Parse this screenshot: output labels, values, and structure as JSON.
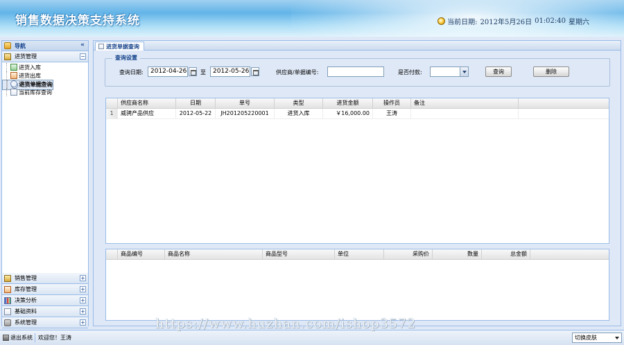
{
  "header": {
    "title": "销售数据决策支持系统",
    "date_label": "当前日期:",
    "date_value": "2012年5月26日",
    "time_value": "01:02:40",
    "weekday": "星期六"
  },
  "sidebar": {
    "title": "导航",
    "collapse_glyph": "«",
    "active_group": {
      "label": "进货管理",
      "toggle": "−",
      "items": [
        {
          "label": "进货入库",
          "icon": "stock-in-icon"
        },
        {
          "label": "进货出库",
          "icon": "stock-out-icon"
        },
        {
          "label": "进货单据查询",
          "icon": "search-doc-icon"
        },
        {
          "label": "退货单据查询",
          "icon": "search-doc-icon"
        },
        {
          "label": "当前库存查询",
          "icon": "doc-icon"
        }
      ],
      "selected_index": 2
    },
    "groups": [
      {
        "label": "销售管理",
        "toggle": "+"
      },
      {
        "label": "库存管理",
        "toggle": "+"
      },
      {
        "label": "决策分析",
        "toggle": "+"
      },
      {
        "label": "基础资料",
        "toggle": "+"
      },
      {
        "label": "系统管理",
        "toggle": "+"
      }
    ]
  },
  "tab": {
    "label": "进货单据查询"
  },
  "query": {
    "legend": "查询设置",
    "date_label": "查询日期:",
    "date_from": "2012-04-26",
    "date_sep": "至",
    "date_to": "2012-05-26",
    "supplier_label": "供应商/单据编号:",
    "supplier_value": "",
    "paid_label": "是否付款:",
    "paid_value": "",
    "search_button": "查询",
    "delete_button": "删除"
  },
  "orders": {
    "columns": [
      "供应商名称",
      "日期",
      "单号",
      "类型",
      "进货金额",
      "操作员",
      "备注"
    ],
    "rows": [
      {
        "num": "1",
        "supplier": "威骋产品供应",
        "date": "2012-05-22",
        "order_no": "JH201205220001",
        "type": "进货入库",
        "amount": "￥16,000.00",
        "operator": "王涛",
        "note": ""
      }
    ]
  },
  "details": {
    "columns": [
      "商品编号",
      "商品名称",
      "商品型号",
      "单位",
      "采购价",
      "数量",
      "总金额"
    ]
  },
  "footer": {
    "logout": "退出系统",
    "welcome": "欢迎您！王涛",
    "skin": "切换皮肤"
  },
  "watermark": "https://www.huzhan.com/ishop3572"
}
